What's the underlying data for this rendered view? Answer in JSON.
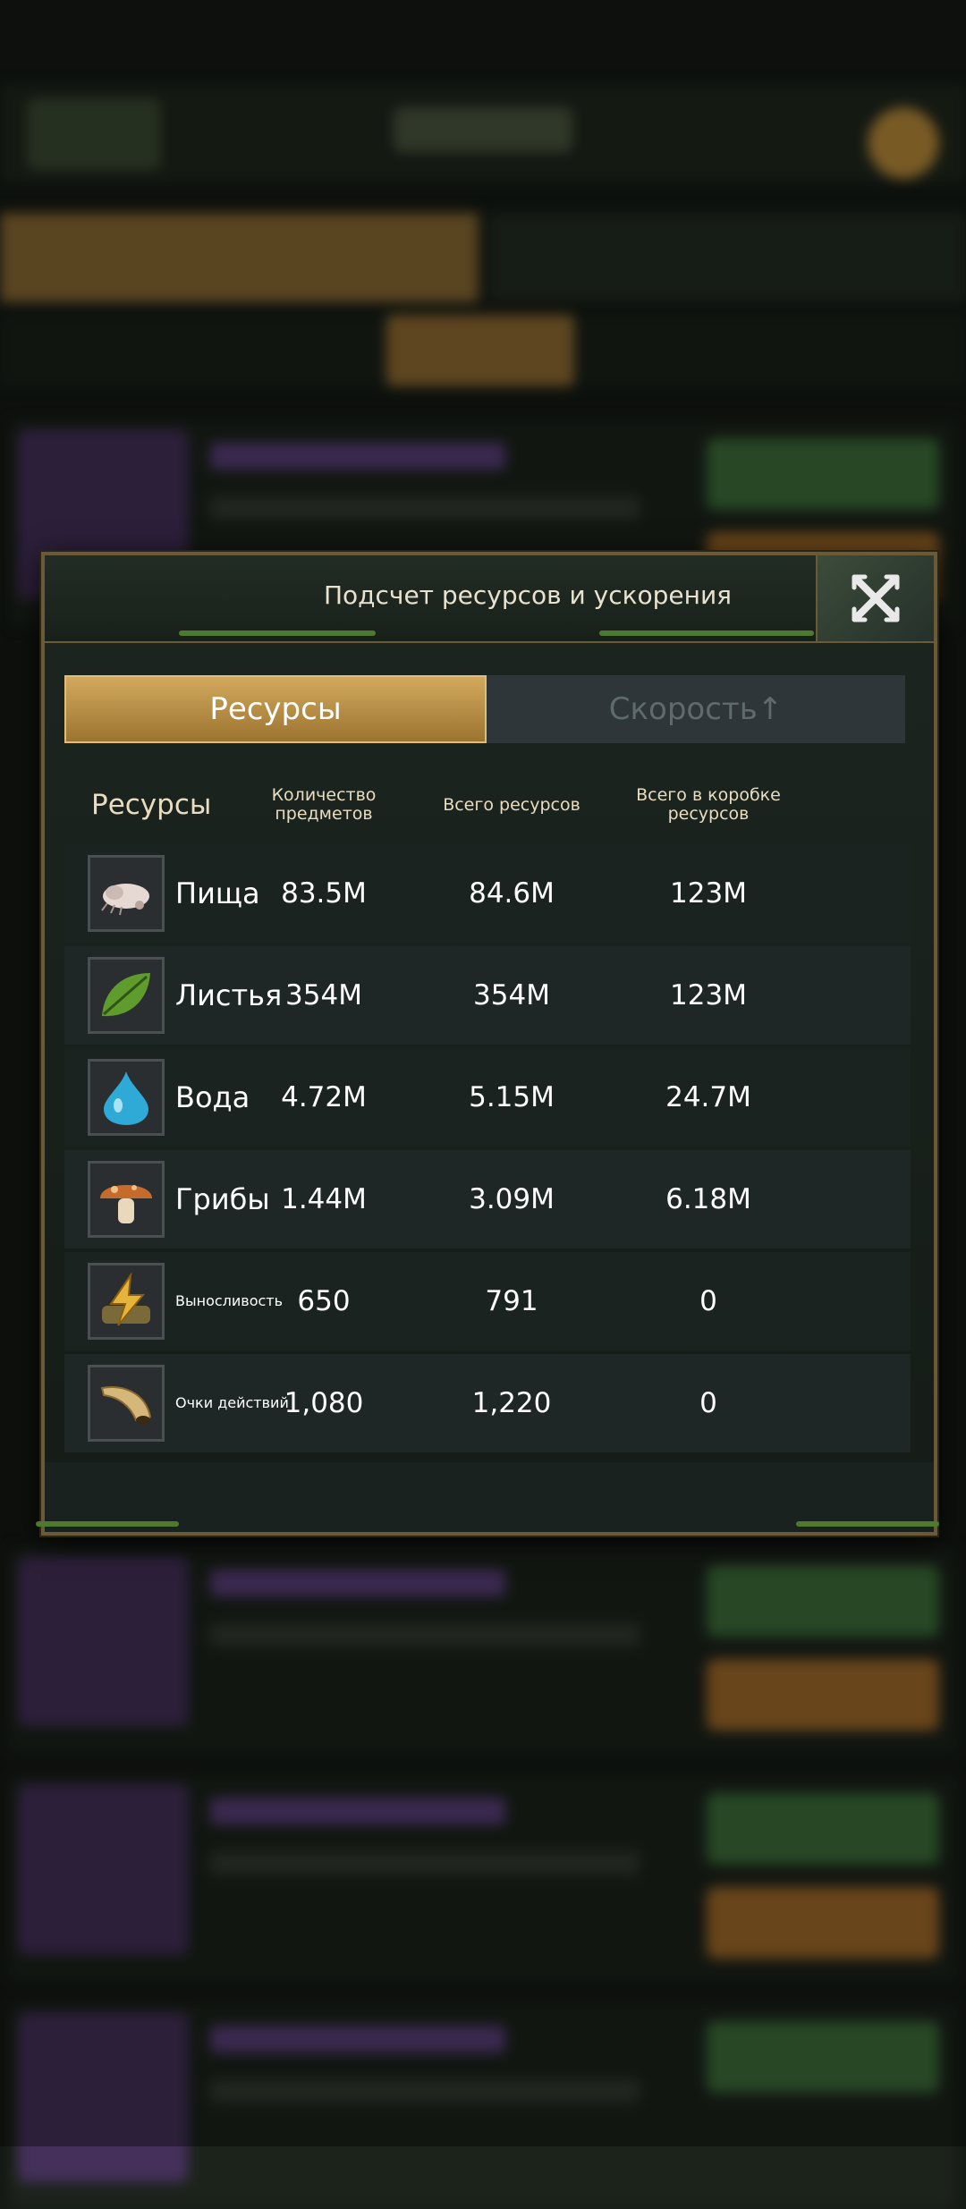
{
  "modal": {
    "title": "Подсчет ресурсов и ускорения",
    "close_icon": "close-x-icon"
  },
  "tabs": [
    {
      "label": "Ресурсы",
      "active": true
    },
    {
      "label": "Скорость↑",
      "active": false
    }
  ],
  "table": {
    "headers": [
      "Ресурсы",
      "Количество предметов",
      "Всего ресурсов",
      "Всего в коробке ресурсов"
    ],
    "rows": [
      {
        "icon": "grub-food-icon",
        "name": "Пища",
        "items": "83.5M",
        "total": "84.6M",
        "box": "123M"
      },
      {
        "icon": "leaf-icon",
        "name": "Листья",
        "items": "354M",
        "total": "354M",
        "box": "123M"
      },
      {
        "icon": "water-drop-icon",
        "name": "Вода",
        "items": "4.72M",
        "total": "5.15M",
        "box": "24.7M"
      },
      {
        "icon": "mushroom-icon",
        "name": "Грибы",
        "items": "1.44M",
        "total": "3.09M",
        "box": "6.18M"
      },
      {
        "icon": "stamina-bolt-icon",
        "name": "Выносливость",
        "items": "650",
        "total": "791",
        "box": "0"
      },
      {
        "icon": "horn-icon",
        "name": "Очки действий",
        "items": "1,080",
        "total": "1,220",
        "box": "0"
      }
    ]
  },
  "colors": {
    "accent_gold": "#c9a052",
    "panel_border": "#6b5a36",
    "background": "#141a14"
  }
}
